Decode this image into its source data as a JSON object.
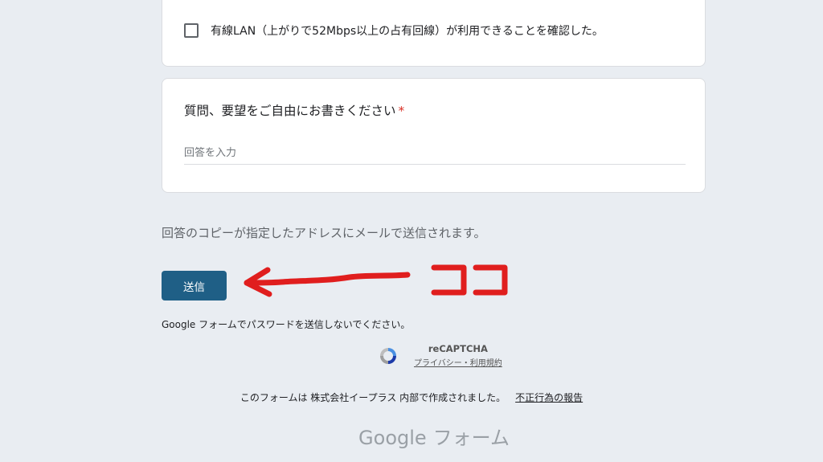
{
  "checkbox_card": {
    "label": "有線LAN（上がりで52Mbps以上の占有回線）が利用できることを確認した。",
    "checked": false
  },
  "question": {
    "title": "質問、要望をご自由にお書きください",
    "required_mark": "*",
    "placeholder": "回答を入力"
  },
  "copy_note": "回答のコピーが指定したアドレスにメールで送信されます。",
  "submit_label": "送信",
  "annotation": {
    "text": "ココ",
    "color": "#e01e1e"
  },
  "password_note": "Google フォームでパスワードを送信しないでください。",
  "recaptcha": {
    "title": "reCAPTCHA",
    "link": "プライバシー・利用規約"
  },
  "footer": {
    "created_note": "このフォームは 株式会社イープラス 内部で作成されました。",
    "report_link": "不正行為の報告"
  },
  "logo": {
    "brand": "Google",
    "product": "フォーム"
  },
  "colors": {
    "page_background": "#e9edf2",
    "submit_button": "#1f5f86"
  }
}
